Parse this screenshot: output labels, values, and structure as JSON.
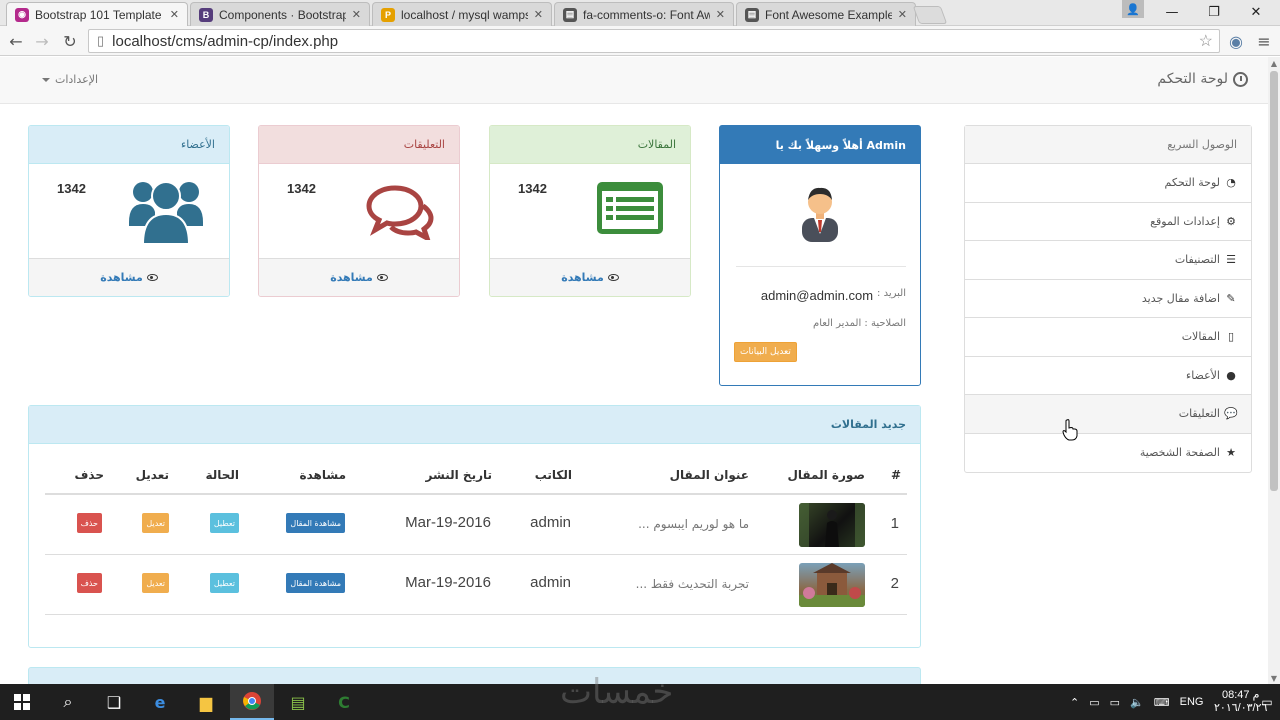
{
  "browser": {
    "tabs": [
      {
        "title": "Bootstrap 101 Template",
        "favicon": "#b42a8c",
        "active": true
      },
      {
        "title": "Components · Bootstrap",
        "favicon": "#563d7c",
        "active": false
      },
      {
        "title": "localhost / mysql wampse",
        "favicon": "#e5a000",
        "active": false
      },
      {
        "title": "fa-comments-o: Font Awe",
        "favicon": "#555555",
        "active": false
      },
      {
        "title": "Font Awesome Examples",
        "favicon": "#555555",
        "active": false
      }
    ],
    "url": "localhost/cms/admin-cp/index.php"
  },
  "topnav": {
    "brand": "لوحة التحكم",
    "settings": "الإعدادات"
  },
  "sidebar": {
    "title": "الوصول السريع",
    "items": [
      {
        "label": "لوحة التحكم",
        "icon": "dashboard-icon"
      },
      {
        "label": "إعدادات الموقع",
        "icon": "gear-icon"
      },
      {
        "label": "التصنيفات",
        "icon": "list-icon"
      },
      {
        "label": "اضافة مقال جديد",
        "icon": "pencil-icon"
      },
      {
        "label": "المقالات",
        "icon": "file-icon"
      },
      {
        "label": "الأعضاء",
        "icon": "user-icon"
      },
      {
        "label": "التعليقات",
        "icon": "comments-icon"
      },
      {
        "label": "الصفحة الشخصية",
        "icon": "star-icon"
      }
    ]
  },
  "welcome": {
    "title": "أهلاً وسهلاً بك يا Admin",
    "email_label": "البريد :",
    "email": "admin@admin.com",
    "role": "الصلاحية : المدير العام",
    "edit_button": "تعديل البيانات"
  },
  "stats": [
    {
      "title": "المقالات",
      "count": "1342",
      "link": "مشاهدة",
      "color": "#3c763d",
      "header_bg": "#dff0d8"
    },
    {
      "title": "التعليقات",
      "count": "1342",
      "link": "مشاهدة",
      "color": "#a94442",
      "header_bg": "#f2dede"
    },
    {
      "title": "الأعضاء",
      "count": "1342",
      "link": "مشاهدة",
      "color": "#31708f",
      "header_bg": "#d9edf7"
    }
  ],
  "articles": {
    "title": "جديد المقالات",
    "headers": [
      "#",
      "صورة المقال",
      "عنوان المقال",
      "الكاتب",
      "تاريخ النشر",
      "مشاهدة",
      "الحالة",
      "تعديل",
      "حذف"
    ],
    "rows": [
      {
        "num": "1",
        "title": "ما هو لوريم ايبسوم ...",
        "author": "admin",
        "date": "Mar-19-2016",
        "view": "مشاهدة المقال",
        "status": "تعطيل",
        "edit": "تعديل",
        "delete": "حذف"
      },
      {
        "num": "2",
        "title": "تجربة التحديث فقط ...",
        "author": "admin",
        "date": "Mar-19-2016",
        "view": "مشاهدة المقال",
        "status": "تعطيل",
        "edit": "تعديل",
        "delete": "حذف"
      }
    ]
  },
  "watermark": "خمسات",
  "taskbar": {
    "lang": "ENG",
    "time": "08:47 م",
    "date": "٢٠١٦/٠٣/٢٦"
  }
}
